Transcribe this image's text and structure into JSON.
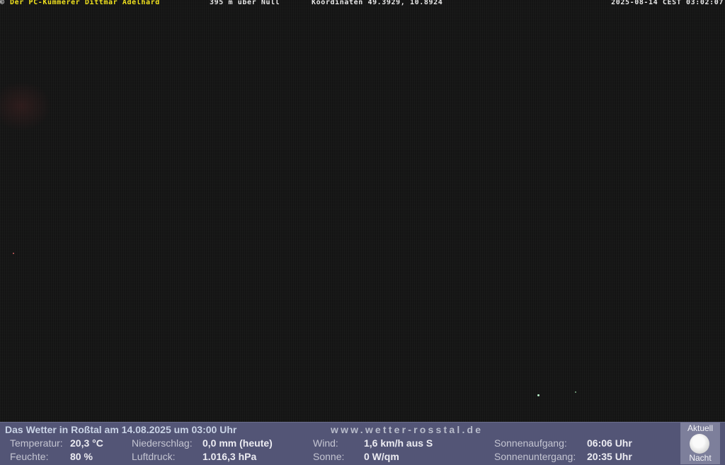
{
  "overlay": {
    "copyright_symbol": "©",
    "owner": "Der PC-Kümmerer Dittmar Adelhard",
    "altitude": "395 m über Null",
    "coordinates": "Koordinaten 49.3929, 10.8924",
    "timestamp": "2025-08-14 CEST 03:02:07"
  },
  "weather": {
    "headline": "Das Wetter in Roßtal am 14.08.2025 um 03:00 Uhr",
    "website": "www.wetter-rosstal.de",
    "temperature_label": "Temperatur:",
    "temperature_value": "20,3 °C",
    "humidity_label": "Feuchte:",
    "humidity_value": "80 %",
    "precip_label": "Niederschlag:",
    "precip_value": "0,0 mm (heute)",
    "pressure_label": "Luftdruck:",
    "pressure_value": "1.016,3 hPa",
    "wind_label": "Wind:",
    "wind_value": "1,6 km/h aus S",
    "sun_label": "Sonne:",
    "sun_value": "0 W/qm",
    "sunrise_label": "Sonnenaufgang:",
    "sunrise_value": "06:06 Uhr",
    "sunset_label": "Sonnenuntergang:",
    "sunset_value": "20:35 Uhr"
  },
  "moon": {
    "top_label": "Aktuell",
    "bottom_label": "Nacht",
    "icon": "full-moon-icon"
  }
}
